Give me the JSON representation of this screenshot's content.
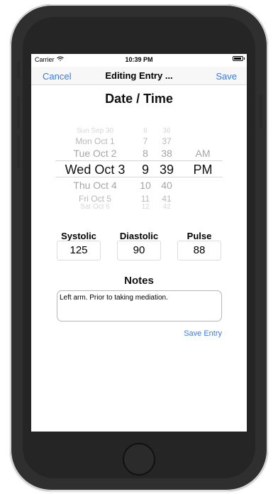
{
  "status_bar": {
    "carrier": "Carrier",
    "time": "10:39 PM"
  },
  "navigation": {
    "cancel": "Cancel",
    "title": "Editing Entry ...",
    "save": "Save"
  },
  "date_time_section": {
    "title": "Date / Time",
    "picker": {
      "dates": [
        "Sun Sep 30",
        "Mon Oct 1",
        "Tue Oct 2",
        "Wed Oct 3",
        "Thu Oct 4",
        "Fri Oct 5",
        "Sat Oct 6"
      ],
      "hours": [
        "6",
        "7",
        "8",
        "9",
        "10",
        "11",
        "12"
      ],
      "minutes": [
        "36",
        "37",
        "38",
        "39",
        "40",
        "41",
        "42"
      ],
      "ampm": [
        "AM",
        "PM"
      ]
    }
  },
  "vitals": {
    "systolic_label": "Systolic",
    "systolic_value": "125",
    "diastolic_label": "Diastolic",
    "diastolic_value": "90",
    "pulse_label": "Pulse",
    "pulse_value": "88"
  },
  "notes": {
    "title": "Notes",
    "text": "Left arm. Prior to taking mediation."
  },
  "actions": {
    "save_entry": "Save Entry"
  },
  "colors": {
    "accent": "#2f7bf6",
    "frame": "#2f2f2f"
  }
}
